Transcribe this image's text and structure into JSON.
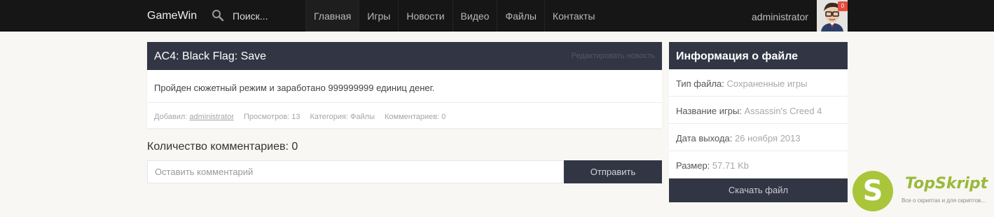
{
  "header": {
    "brand": "GameWin",
    "search_placeholder": "Поиск...",
    "nav": [
      "Главная",
      "Игры",
      "Новости",
      "Видео",
      "Файлы",
      "Контакты"
    ],
    "user": "administrator",
    "notifications": "0"
  },
  "article": {
    "title": "AC4: Black Flag: Save",
    "edit_label": "Редактировать новость",
    "body": "Пройден сюжетный режим и заработано 999999999 единиц денег.",
    "meta": {
      "added_label": "Добавил:",
      "author": "administrator",
      "views": "Просмотров: 13",
      "category": "Категория: Файлы",
      "comments": "Комментариев: 0"
    }
  },
  "comments": {
    "title": "Количество комментариев: 0",
    "placeholder": "Оставить комментарий",
    "send_label": "Отправить"
  },
  "file_info": {
    "title": "Информация о файле",
    "rows": [
      {
        "label": "Тип файла:",
        "value": "Сохраненные игры"
      },
      {
        "label": "Название игры:",
        "value": "Assassin's Creed 4"
      },
      {
        "label": "Дата выхода:",
        "value": "26 ноября 2013"
      },
      {
        "label": "Размер:",
        "value": "57.71 Kb"
      }
    ],
    "download_label": "Скачать файл"
  },
  "watermark": {
    "letter": "S",
    "name": "TopSkript",
    "tagline": "Все о скриптах и для скриптов..."
  },
  "colors": {
    "topbar": "#161616",
    "panel_header": "#323644",
    "accent_green": "#a9c63b",
    "badge_red": "#e74c3c"
  }
}
